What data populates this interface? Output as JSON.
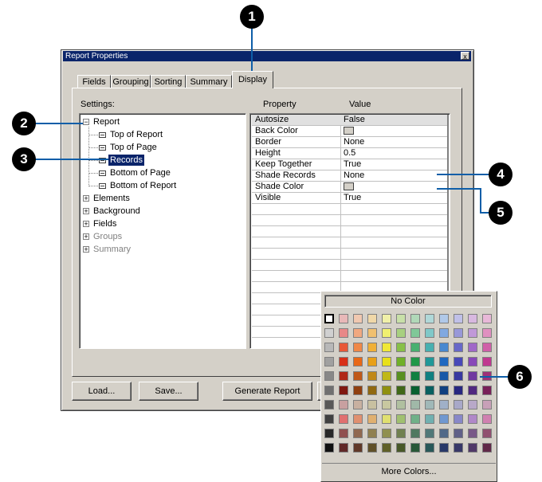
{
  "dialog": {
    "title": "Report Properties",
    "close_glyph": "x",
    "tabs": [
      "Fields",
      "Grouping",
      "Sorting",
      "Summary",
      "Display"
    ],
    "active_tab": "Display"
  },
  "settings": {
    "label": "Settings:",
    "tree": {
      "report": {
        "glyph": "−",
        "label": "Report"
      },
      "children": [
        "Top of Report",
        "Top of Page",
        "Records",
        "Bottom of Page",
        "Bottom of Report"
      ],
      "selected": "Records",
      "roots": [
        {
          "glyph": "+",
          "label": "Elements",
          "enabled": true
        },
        {
          "glyph": "+",
          "label": "Background",
          "enabled": true
        },
        {
          "glyph": "+",
          "label": "Fields",
          "enabled": true
        },
        {
          "glyph": "+",
          "label": "Groups",
          "enabled": false
        },
        {
          "glyph": "+",
          "label": "Summary",
          "enabled": false
        }
      ]
    }
  },
  "properties": {
    "header_property": "Property",
    "header_value": "Value",
    "rows": [
      {
        "name": "Autosize",
        "value": "False"
      },
      {
        "name": "Back Color",
        "value": ""
      },
      {
        "name": "Border",
        "value": "None"
      },
      {
        "name": "Height",
        "value": "0.5"
      },
      {
        "name": "Keep Together",
        "value": "True"
      },
      {
        "name": "Shade Records",
        "value": "None"
      },
      {
        "name": "Shade Color",
        "value": ""
      },
      {
        "name": "Visible",
        "value": "True"
      }
    ]
  },
  "buttons": {
    "load": "Load...",
    "save": "Save...",
    "generate": "Generate Report"
  },
  "palette": {
    "no_color": "No Color",
    "more_colors": "More Colors...",
    "rows": [
      [
        "#ffffff",
        "#e8b8b8",
        "#f0c8b0",
        "#f0d8a8",
        "#f0f0a8",
        "#c8e0a8",
        "#b0d8b8",
        "#b0d8d8",
        "#b0c8e8",
        "#c0c0e8",
        "#d8b8e0",
        "#e8b8d8"
      ],
      [
        "#d0d0d0",
        "#e88888",
        "#f0a880",
        "#f0c070",
        "#f0f070",
        "#a8d080",
        "#80c898",
        "#80c8c8",
        "#80a8e0",
        "#9898d8",
        "#c098d8",
        "#e090c0"
      ],
      [
        "#b8b8b8",
        "#e85838",
        "#f08848",
        "#f0b038",
        "#f0e838",
        "#88c048",
        "#48b070",
        "#48b0b0",
        "#4888d0",
        "#6868c8",
        "#a068c8",
        "#d060a8"
      ],
      [
        "#a0a0a0",
        "#d83018",
        "#e86818",
        "#e8a018",
        "#e8e018",
        "#70b028",
        "#209848",
        "#209898",
        "#2068c0",
        "#4848b8",
        "#8848b8",
        "#c03890"
      ],
      [
        "#888888",
        "#b02818",
        "#c05818",
        "#c08818",
        "#c0b818",
        "#589020",
        "#108040",
        "#108080",
        "#1858a8",
        "#3838a0",
        "#7038a0",
        "#a03078"
      ],
      [
        "#707070",
        "#801810",
        "#904010",
        "#906810",
        "#909010",
        "#406818",
        "#086030",
        "#086060",
        "#104080",
        "#282880",
        "#502880",
        "#782058"
      ],
      [
        "#585858",
        "#c8a0a0",
        "#c8b0a0",
        "#c8c0a0",
        "#c8c8a0",
        "#b0c0a0",
        "#a0b8a8",
        "#a0b8b8",
        "#a0b0c8",
        "#a8a8c8",
        "#b8a8c8",
        "#c8a0b8"
      ],
      [
        "#404040",
        "#e07070",
        "#e09070",
        "#e0b070",
        "#e0e070",
        "#a0c070",
        "#70b088",
        "#70b0b0",
        "#7098d0",
        "#8888c8",
        "#b088c8",
        "#d080b0"
      ],
      [
        "#282828",
        "#905050",
        "#906850",
        "#908050",
        "#909050",
        "#708050",
        "#507860",
        "#507878",
        "#506888",
        "#606088",
        "#785888",
        "#905070"
      ],
      [
        "#101010",
        "#602828",
        "#603828",
        "#605028",
        "#606028",
        "#485828",
        "#285838",
        "#285858",
        "#283868",
        "#383868",
        "#503868",
        "#602848"
      ]
    ]
  },
  "callouts": [
    "1",
    "2",
    "3",
    "4",
    "5",
    "6"
  ],
  "colors": {
    "accent": "#0a246a",
    "callout_line": "#0e5ea8",
    "dialog_face": "#d4d0c8"
  }
}
